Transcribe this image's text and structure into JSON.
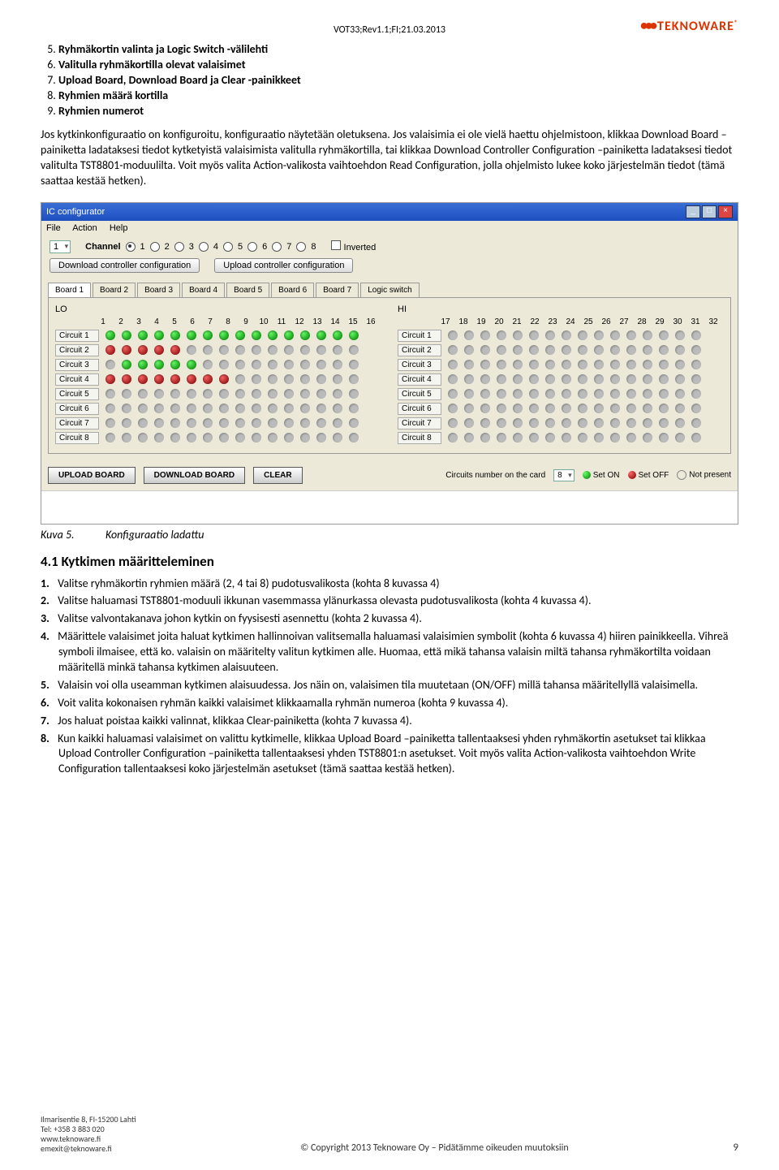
{
  "header": "VOT33;Rev1.1;FI;21.03.2013",
  "logo": {
    "name": "TEKNOWARE",
    "reg": "®"
  },
  "topList": [
    "Ryhmäkortin valinta ja Logic Switch -välilehti",
    "Valitulla ryhmäkortilla olevat valaisimet",
    "Upload Board, Download Board ja Clear -painikkeet",
    "Ryhmien määrä kortilla",
    "Ryhmien numerot"
  ],
  "topListStart": "5",
  "para1": "Jos kytkinkonfiguraatio on konfiguroitu, konfiguraatio näytetään oletuksena. Jos valaisimia ei ole vielä haettu ohjelmistoon, klikkaa Download Board –painiketta ladataksesi tiedot kytketyistä valaisimista valitulla ryhmäkortilla, tai klikkaa Download Controller Configuration –painiketta ladataksesi tiedot valitulta TST8801-moduulilta. Voit myös valita Action-valikosta vaihtoehdon Read Configuration, jolla ohjelmisto lukee koko järjestelmän tiedot (tämä saattaa kestää hetken).",
  "shot": {
    "title": "IC configurator",
    "menu": [
      "File",
      "Action",
      "Help"
    ],
    "selVal": "1",
    "channelLabel": "Channel",
    "channels": [
      "1",
      "2",
      "3",
      "4",
      "5",
      "6",
      "7",
      "8"
    ],
    "inverted": "Inverted",
    "btnDown": "Download controller configuration",
    "btnUp": "Upload controller configuration",
    "tabs": [
      "Board 1",
      "Board 2",
      "Board 3",
      "Board 4",
      "Board 5",
      "Board 6",
      "Board 7",
      "Logic switch"
    ],
    "lo": "LO",
    "hi": "HI",
    "numsL": [
      "1",
      "2",
      "3",
      "4",
      "5",
      "6",
      "7",
      "8",
      "9",
      "10",
      "11",
      "12",
      "13",
      "14",
      "15",
      "16"
    ],
    "numsR": [
      "17",
      "18",
      "19",
      "20",
      "21",
      "22",
      "23",
      "24",
      "25",
      "26",
      "27",
      "28",
      "29",
      "30",
      "31",
      "32"
    ],
    "circuits": [
      "Circuit 1",
      "Circuit 2",
      "Circuit 3",
      "Circuit 4",
      "Circuit 5",
      "Circuit 6",
      "Circuit 7",
      "Circuit 8"
    ],
    "rowsL": [
      [
        "g",
        "g",
        "g",
        "g",
        "g",
        "g",
        "g",
        "g",
        "g",
        "g",
        "g",
        "g",
        "g",
        "g",
        "g",
        "g"
      ],
      [
        "r",
        "r",
        "r",
        "r",
        "r",
        "",
        "",
        "",
        "",
        "",
        "",
        "",
        "",
        "",
        "",
        ""
      ],
      [
        "",
        "g",
        "g",
        "g",
        "g",
        "g",
        "",
        "",
        "",
        "",
        "",
        "",
        "",
        "",
        "",
        ""
      ],
      [
        "r",
        "r",
        "r",
        "r",
        "r",
        "r",
        "r",
        "r",
        "",
        "",
        "",
        "",
        "",
        "",
        "",
        ""
      ],
      [
        "",
        "",
        "",
        "",
        "",
        "",
        "",
        "",
        "",
        "",
        "",
        "",
        "",
        "",
        "",
        ""
      ],
      [
        "",
        "",
        "",
        "",
        "",
        "",
        "",
        "",
        "",
        "",
        "",
        "",
        "",
        "",
        "",
        ""
      ],
      [
        "",
        "",
        "",
        "",
        "",
        "",
        "",
        "",
        "",
        "",
        "",
        "",
        "",
        "",
        "",
        ""
      ],
      [
        "",
        "",
        "",
        "",
        "",
        "",
        "",
        "",
        "",
        "",
        "",
        "",
        "",
        "",
        "",
        ""
      ]
    ],
    "upload": "UPLOAD BOARD",
    "download": "DOWNLOAD BOARD",
    "clear": "CLEAR",
    "circNum": "Circuits number on the card",
    "circNumVal": "8",
    "setOn": "Set ON",
    "setOff": "Set OFF",
    "notPres": "Not present"
  },
  "caption": {
    "k": "Kuva 5.",
    "t": "Konfiguraatio ladattu"
  },
  "h41": "4.1 Kytkimen määritteleminen",
  "steps": [
    "Valitse ryhmäkortin ryhmien määrä (2, 4 tai 8) pudotusvalikosta (kohta 8 kuvassa 4)",
    "Valitse haluamasi TST8801-moduuli ikkunan vasemmassa ylänurkassa olevasta pudotusvalikosta (kohta 4 kuvassa 4).",
    "Valitse valvontakanava johon kytkin on fyysisesti asennettu (kohta 2 kuvassa 4).",
    "Määrittele valaisimet joita haluat kytkimen hallinnoivan valitsemalla haluamasi valaisimien symbolit (kohta 6 kuvassa 4) hiiren painikkeella. Vihreä symboli ilmaisee, että ko. valaisin on määritelty valitun kytkimen alle. Huomaa, että mikä tahansa valaisin miltä tahansa ryhmäkortilta voidaan määritellä minkä tahansa kytkimen alaisuuteen.",
    "Valaisin voi olla useamman kytkimen alaisuudessa. Jos näin on, valaisimen tila muutetaan (ON/OFF) millä tahansa määritellyllä valaisimella.",
    "Voit valita kokonaisen ryhmän kaikki valaisimet klikkaamalla ryhmän numeroa (kohta 9 kuvassa 4).",
    "Jos haluat poistaa kaikki valinnat, klikkaa Clear-painiketta (kohta 7 kuvassa 4).",
    "Kun kaikki haluamasi valaisimet on valittu kytkimelle, klikkaa Upload Board –painiketta tallentaaksesi yhden ryhmäkortin asetukset tai klikkaa Upload Controller Configuration –painiketta tallentaaksesi yhden TST8801:n asetukset. Voit myös valita Action-valikosta vaihtoehdon Write Configuration tallentaaksesi koko järjestelmän asetukset (tämä saattaa kestää hetken)."
  ],
  "footer": {
    "addr": [
      "Ilmarisentie 8, FI-15200 Lahti",
      "Tel: +358 3 883 020",
      "www.teknoware.fi",
      "emexit@teknoware.fi"
    ],
    "copy": "© Copyright 2013 Teknoware Oy – Pidätämme oikeuden muutoksiin",
    "page": "9"
  }
}
